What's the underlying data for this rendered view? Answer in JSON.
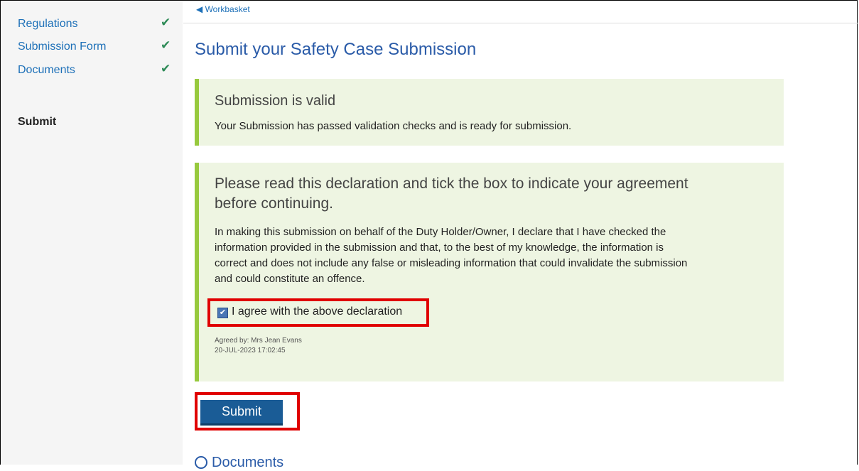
{
  "sidebar": {
    "items": [
      {
        "label": "Regulations",
        "check": "✔"
      },
      {
        "label": "Submission Form",
        "check": "✔"
      },
      {
        "label": "Documents",
        "check": "✔"
      }
    ],
    "current": "Submit"
  },
  "main": {
    "back_link": "◀ Workbasket",
    "title": "Submit your Safety Case Submission",
    "valid_panel": {
      "title": "Submission is valid",
      "text": "Your Submission has passed validation checks and is ready for submission."
    },
    "declaration_panel": {
      "title_line1": "Please read this declaration and tick the box to indicate your agreement",
      "title_line2": "before continuing.",
      "text_lines": [
        "In making this submission on behalf of the Duty Holder/Owner, I declare that I have checked the",
        "information provided in the submission and that, to the best of my knowledge, the information is",
        "correct and does not include any false or misleading information that could invalidate the submission",
        "and could constitute an offence."
      ],
      "agree_label": "I agree with the above declaration",
      "agreed_by": "Agreed by: Mrs Jean Evans",
      "agreed_at": "20-JUL-2023 17:02:45"
    },
    "submit_label": "Submit",
    "documents_label": "Documents"
  },
  "colors": {
    "accent": "#97c93d",
    "link": "#1d70b8",
    "button": "#1a5c96",
    "highlight": "#e00000"
  }
}
